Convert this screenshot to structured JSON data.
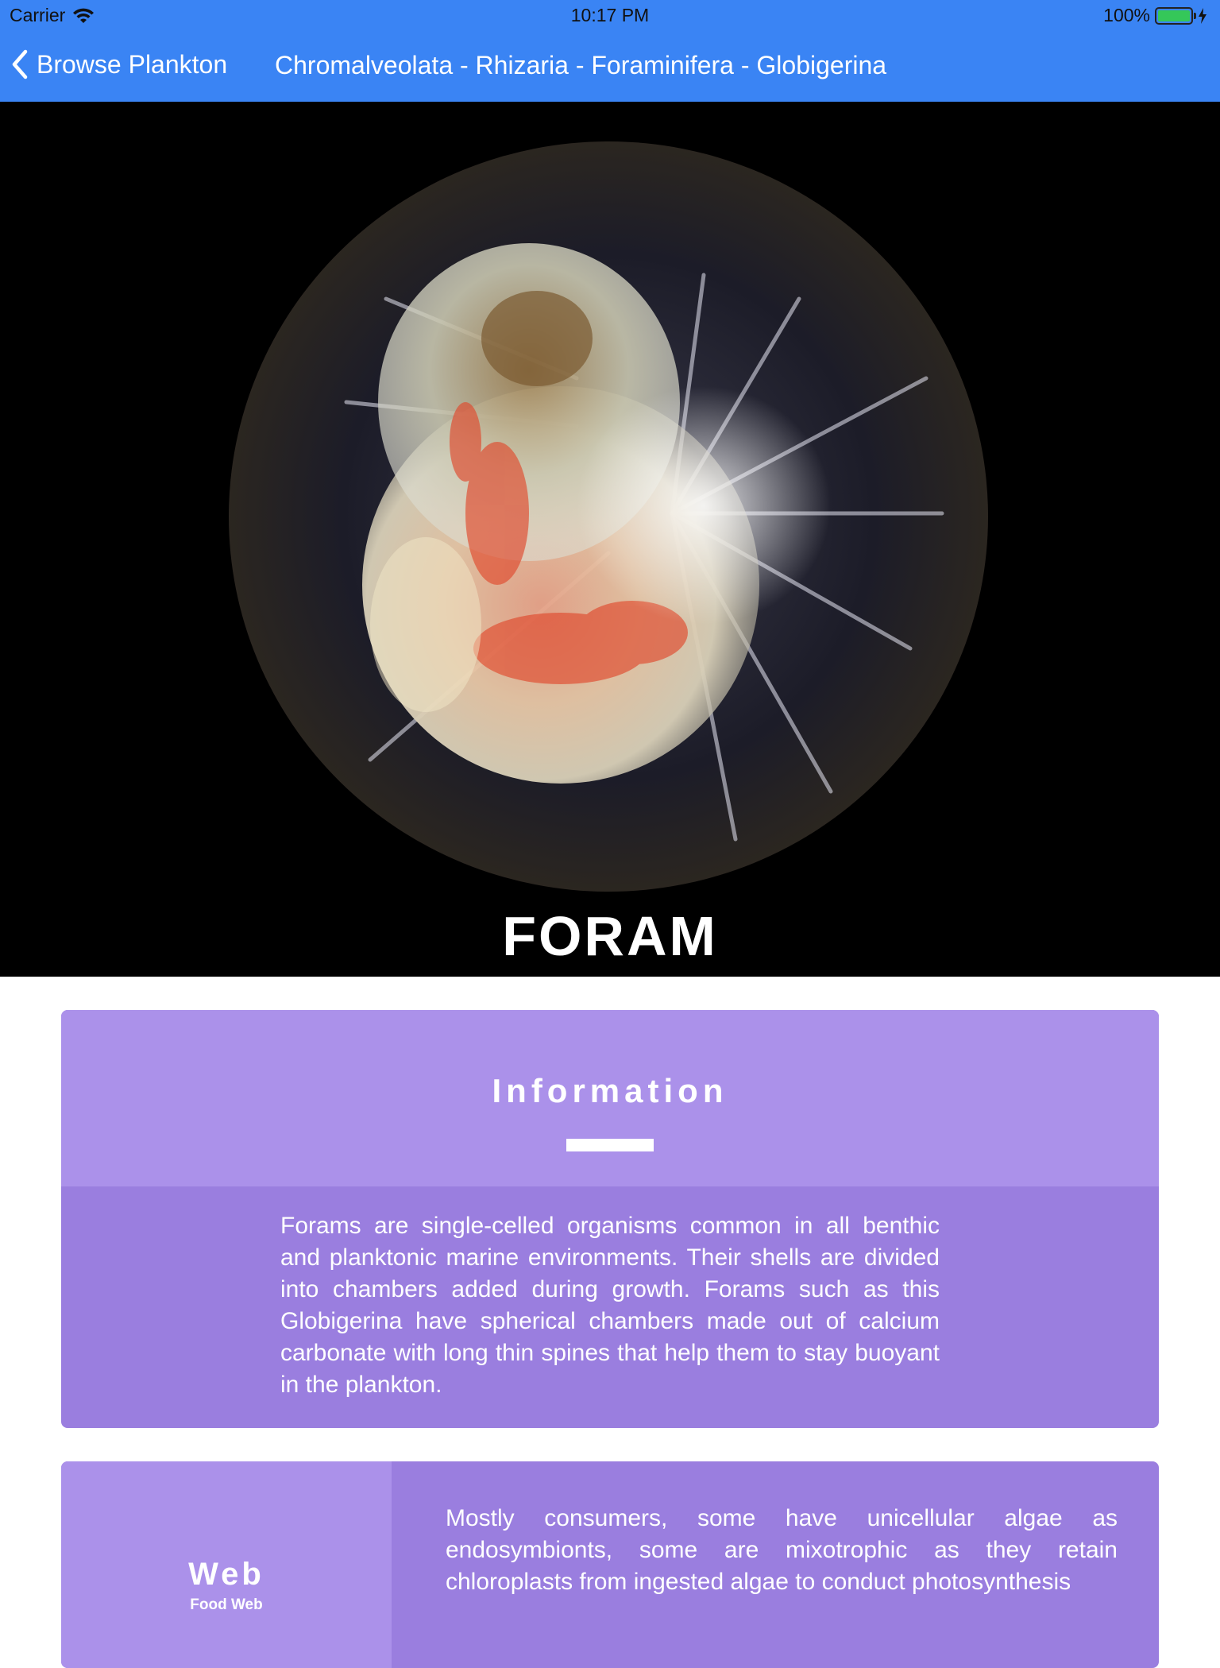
{
  "status_bar": {
    "carrier": "Carrier",
    "time": "10:17 PM",
    "battery": "100%"
  },
  "nav": {
    "back_label": "Browse Plankton",
    "title": "Chromalveolata - Rhizaria - Foraminifera - Globigerina"
  },
  "hero": {
    "title": "FORAM"
  },
  "information": {
    "heading": "Information",
    "body": "Forams are single-celled organisms common in all benthic and planktonic marine environments. Their shells are divided into chambers added during growth. Forams such as this Globigerina have spherical chambers made out of calcium carbonate with long thin spines that help them to stay buoyant in the plankton."
  },
  "web": {
    "label": "Web",
    "sublabel": "Food Web",
    "body": "Mostly consumers, some have unicellular algae as endosymbionts, some are mixotrophic as they retain chloroplasts from ingested algae to conduct photosynthesis"
  },
  "colors": {
    "nav_blue": "#3a84f4",
    "card_light": "#ab91ea",
    "card_dark": "#9a7edf",
    "battery_green": "#35c759"
  },
  "icons": [
    "wifi-icon",
    "battery-icon",
    "bolt-icon",
    "chevron-left-icon"
  ]
}
